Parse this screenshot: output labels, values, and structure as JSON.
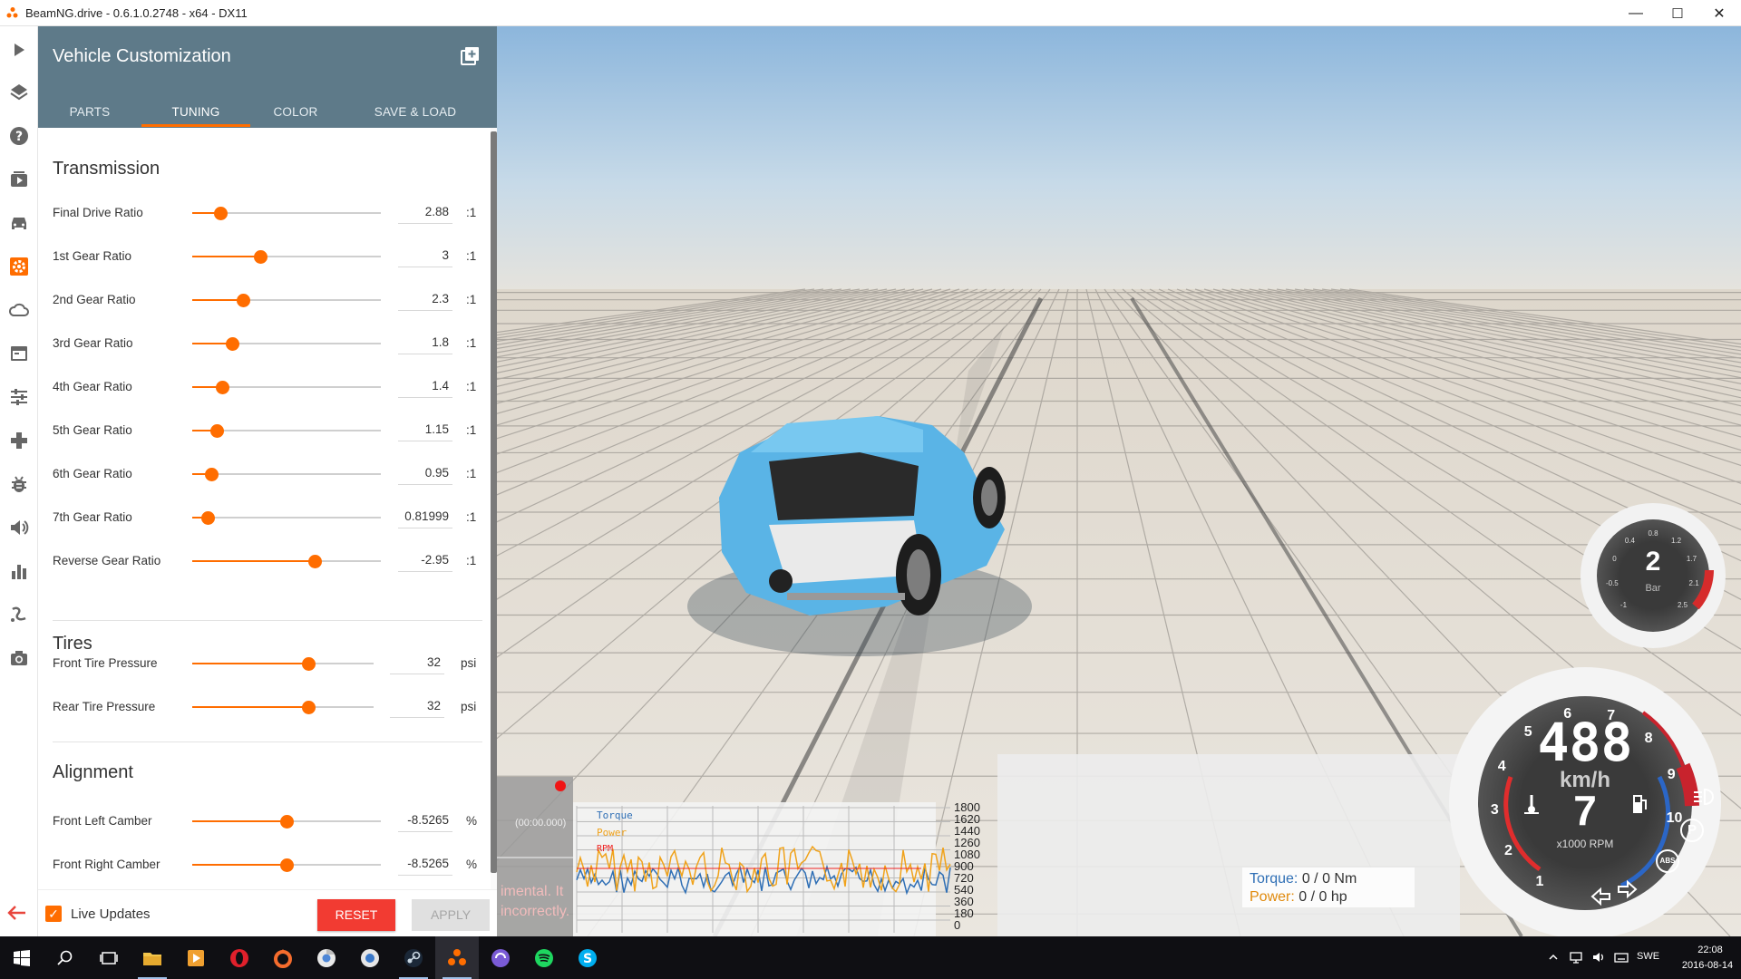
{
  "window": {
    "title": "BeamNG.drive - 0.6.1.0.2748 - x64 - DX11",
    "minimize_glyph": "—",
    "maximize_glyph": "☐",
    "close_glyph": "✕"
  },
  "rail": {
    "icons": [
      "play-icon",
      "layers-icon",
      "help-icon",
      "media-icon",
      "car-icon",
      "gear-icon",
      "cloud-icon",
      "window-icon",
      "sliders-icon",
      "gamepad-icon",
      "bug-icon",
      "volume-icon",
      "bar-chart-icon",
      "route-icon",
      "camera-icon"
    ],
    "active_icon": "gear-icon",
    "accent": "#ff6d00"
  },
  "panel": {
    "title": "Vehicle Customization",
    "header_color": "#5e7a89",
    "tabs": [
      {
        "label": "PARTS"
      },
      {
        "label": "TUNING"
      },
      {
        "label": "COLOR"
      },
      {
        "label": "SAVE & LOAD"
      }
    ],
    "active_tab": "TUNING",
    "sections": {
      "transmission": {
        "title": "Transmission",
        "rows": [
          {
            "label": "Final Drive Ratio",
            "value": "2.88",
            "unit": ":1",
            "level": 0.15
          },
          {
            "label": "1st Gear Ratio",
            "value": "3",
            "unit": ":1",
            "level": 0.36
          },
          {
            "label": "2nd Gear Ratio",
            "value": "2.3",
            "unit": ":1",
            "level": 0.27
          },
          {
            "label": "3rd Gear Ratio",
            "value": "1.8",
            "unit": ":1",
            "level": 0.21
          },
          {
            "label": "4th Gear Ratio",
            "value": "1.4",
            "unit": ":1",
            "level": 0.16
          },
          {
            "label": "5th Gear Ratio",
            "value": "1.15",
            "unit": ":1",
            "level": 0.13
          },
          {
            "label": "6th Gear Ratio",
            "value": "0.95",
            "unit": ":1",
            "level": 0.1
          },
          {
            "label": "7th Gear Ratio",
            "value": "0.81999",
            "unit": ":1",
            "level": 0.08
          },
          {
            "label": "Reverse Gear Ratio",
            "value": "-2.95",
            "unit": ":1",
            "level": 0.65
          }
        ]
      },
      "tires": {
        "title": "Tires",
        "rows": [
          {
            "label": "Front Tire Pressure",
            "value": "32",
            "unit": "psi",
            "level": 0.64
          },
          {
            "label": "Rear Tire Pressure",
            "value": "32",
            "unit": "psi",
            "level": 0.64
          }
        ]
      },
      "alignment": {
        "title": "Alignment",
        "rows": [
          {
            "label": "Front Left Camber",
            "value": "-8.5265",
            "unit": "%",
            "level": 0.5
          },
          {
            "label": "Front Right Camber",
            "value": "-8.5265",
            "unit": "%",
            "level": 0.5
          }
        ]
      }
    },
    "footer": {
      "live_updates_label": "Live Updates",
      "live_updates_checked": true,
      "reset_label": "RESET",
      "apply_label": "APPLY"
    }
  },
  "viewport": {
    "recorder_time": "(00:00.000)",
    "warning_fragment_1": "imental. It",
    "warning_fragment_2": "incorrectly.",
    "graph_legend": [
      "Torque",
      "Power",
      "RPM"
    ],
    "graph_ticks": [
      "1800",
      "1620",
      "1440",
      "1260",
      "1080",
      "900",
      "720",
      "540",
      "360",
      "180",
      "0"
    ],
    "torque_label": "Torque:",
    "torque_value": "0 / 0 Nm",
    "power_label": "Power:",
    "power_value": "0 / 0 hp",
    "boost_gauge": {
      "value": "2",
      "unit": "Bar",
      "ticks": [
        "-1",
        "-0.5",
        "0",
        "0.4",
        "0.8",
        "1.2",
        "1.7",
        "2.1",
        "2.5"
      ]
    },
    "speedo": {
      "speed": "488",
      "speed_unit": "km/h",
      "gear": "7",
      "rpm_unit": "x1000 RPM",
      "rpm_ticks": [
        "1",
        "2",
        "3",
        "4",
        "5",
        "6",
        "7",
        "8",
        "9",
        "10"
      ],
      "park_label": "P",
      "abs_label": "ABS"
    }
  },
  "taskbar": {
    "apps": [
      "start-icon",
      "search-icon",
      "task-view-icon",
      "file-explorer-icon",
      "media-player-icon",
      "opera-icon",
      "origin-icon",
      "chrome-icon",
      "uplay-icon",
      "steam-icon",
      "beamng-icon",
      "app-icon",
      "spotify-icon",
      "skype-icon"
    ],
    "language": "SWE",
    "time": "22:08",
    "date": "2016-08-14"
  }
}
